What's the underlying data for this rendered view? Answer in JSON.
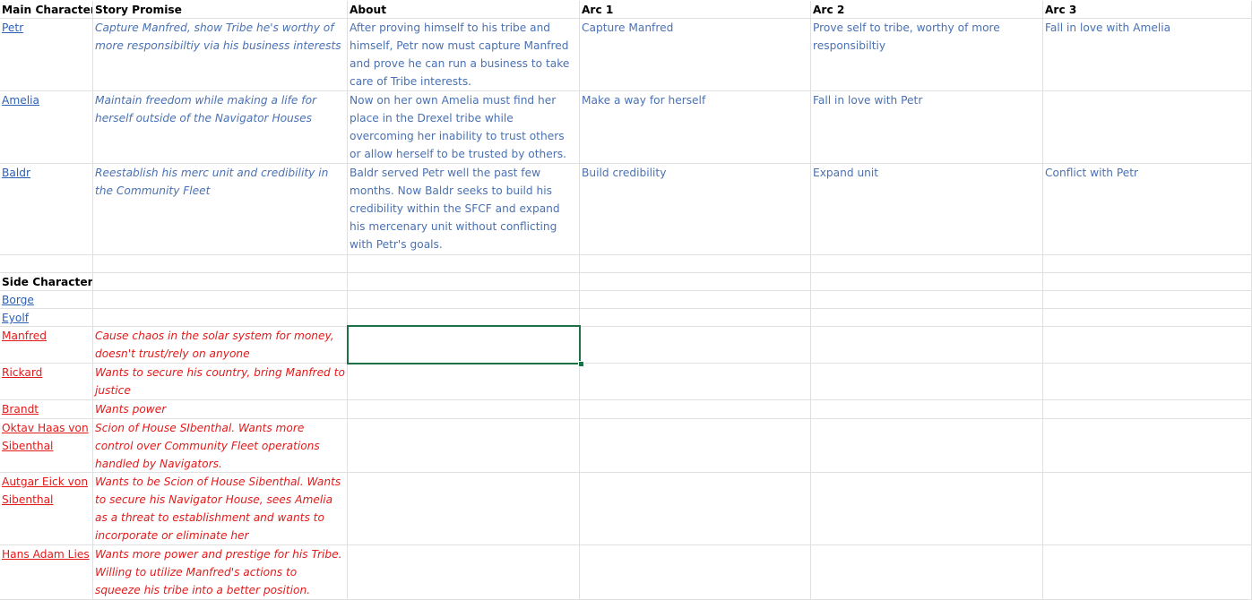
{
  "headers": {
    "main_character": "Main Character",
    "story_promise": "Story Promise",
    "about": "About",
    "arc1": "Arc 1",
    "arc2": "Arc 2",
    "arc3": "Arc 3"
  },
  "main_characters": [
    {
      "name": "Petr",
      "promise": "Capture Manfred, show Tribe he's worthy of more responsibiltiy via his business interests",
      "about": "After proving himself to his tribe and himself, Petr now must capture Manfred and prove he can run a business to take care of Tribe interests.",
      "arc1": "Capture Manfred",
      "arc2": "Prove self to tribe, worthy of more responsibiltiy",
      "arc3": "Fall in love with Amelia"
    },
    {
      "name": "Amelia",
      "promise": "Maintain freedom while making a life for herself outside of the Navigator Houses",
      "about": "Now on her own Amelia must find her place in the Drexel tribe while overcoming her inability to trust others or allow herself to be trusted by others.",
      "arc1": "Make a way for herself",
      "arc2": "Fall in love with Petr",
      "arc3": ""
    },
    {
      "name": "Baldr",
      "promise": "Reestablish his merc unit and credibility in the Community Fleet",
      "about": "Baldr served Petr well the past few months. Now Baldr seeks to build his credibility within the SFCF and expand his mercenary unit without conflicting with Petr's goals.",
      "arc1": "Build credibility",
      "arc2": "Expand unit",
      "arc3": "Conflict with Petr"
    }
  ],
  "side_header": "Side Characters",
  "side_characters": [
    {
      "name": "Borge",
      "promise": ""
    },
    {
      "name": "Eyolf",
      "promise": ""
    },
    {
      "name": "Manfred",
      "promise": "Cause chaos in the solar system for money, doesn't trust/rely on anyone"
    },
    {
      "name": "Rickard",
      "promise": "Wants to secure his country, bring Manfred to justice"
    },
    {
      "name": "Brandt",
      "promise": "Wants power"
    },
    {
      "name": "Oktav Haas von Sibenthal",
      "promise": "Scion of House SIbenthal. Wants more control over Community Fleet operations handled by Navigators."
    },
    {
      "name": "Autgar Eick von Sibenthal",
      "promise": "Wants to be Scion of House Sibenthal. Wants to secure his Navigator House, sees Amelia as a threat to establishment and wants to incorporate or eliminate her"
    },
    {
      "name": "Hans Adam Lies",
      "promise": "Wants more power and prestige for his Tribe. Willing to utilize Manfred's actions to squeeze his tribe into a better position."
    }
  ]
}
